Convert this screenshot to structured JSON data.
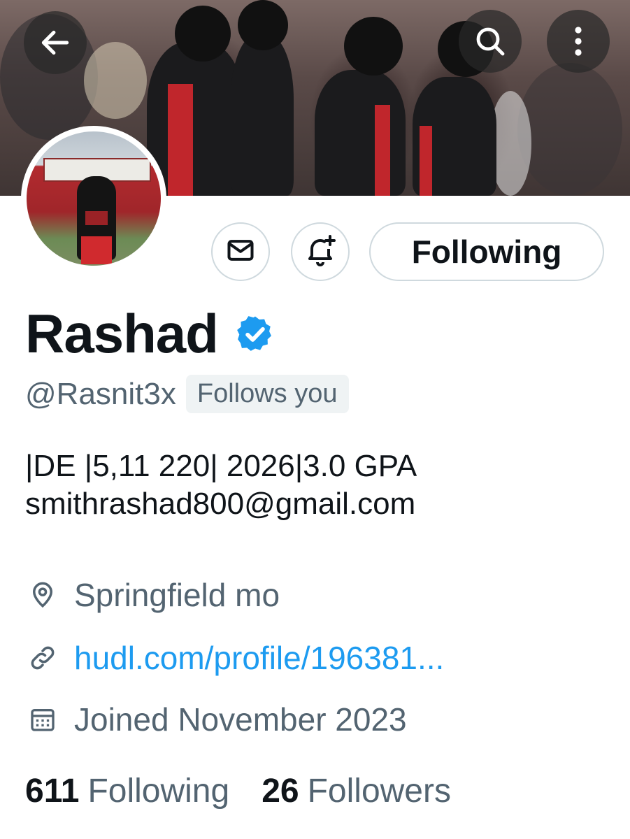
{
  "header": {
    "back_icon": "arrow-left-icon",
    "search_icon": "search-icon",
    "more_icon": "more-vertical-icon"
  },
  "profile": {
    "display_name": "Rashad",
    "verified": true,
    "verified_color": "#1d9bf0",
    "handle": "@Rasnit3x",
    "follows_you": "Follows you",
    "bio_lines": [
      "|DE |5,11 220| 2026|3.0 GPA",
      "smithrashad800@gmail.com"
    ],
    "location": "Springfield mo",
    "website": "hudl.com/profile/196381...",
    "joined": "Joined November 2023"
  },
  "actions": {
    "message_icon": "envelope-icon",
    "notify_icon": "bell-plus-icon",
    "following_label": "Following"
  },
  "stats": {
    "following_count": "611",
    "following_label": "Following",
    "followers_count": "26",
    "followers_label": "Followers"
  },
  "colors": {
    "text_primary": "#0f1419",
    "text_secondary": "#536471",
    "link": "#1d9bf0",
    "border": "#cfd9de"
  }
}
